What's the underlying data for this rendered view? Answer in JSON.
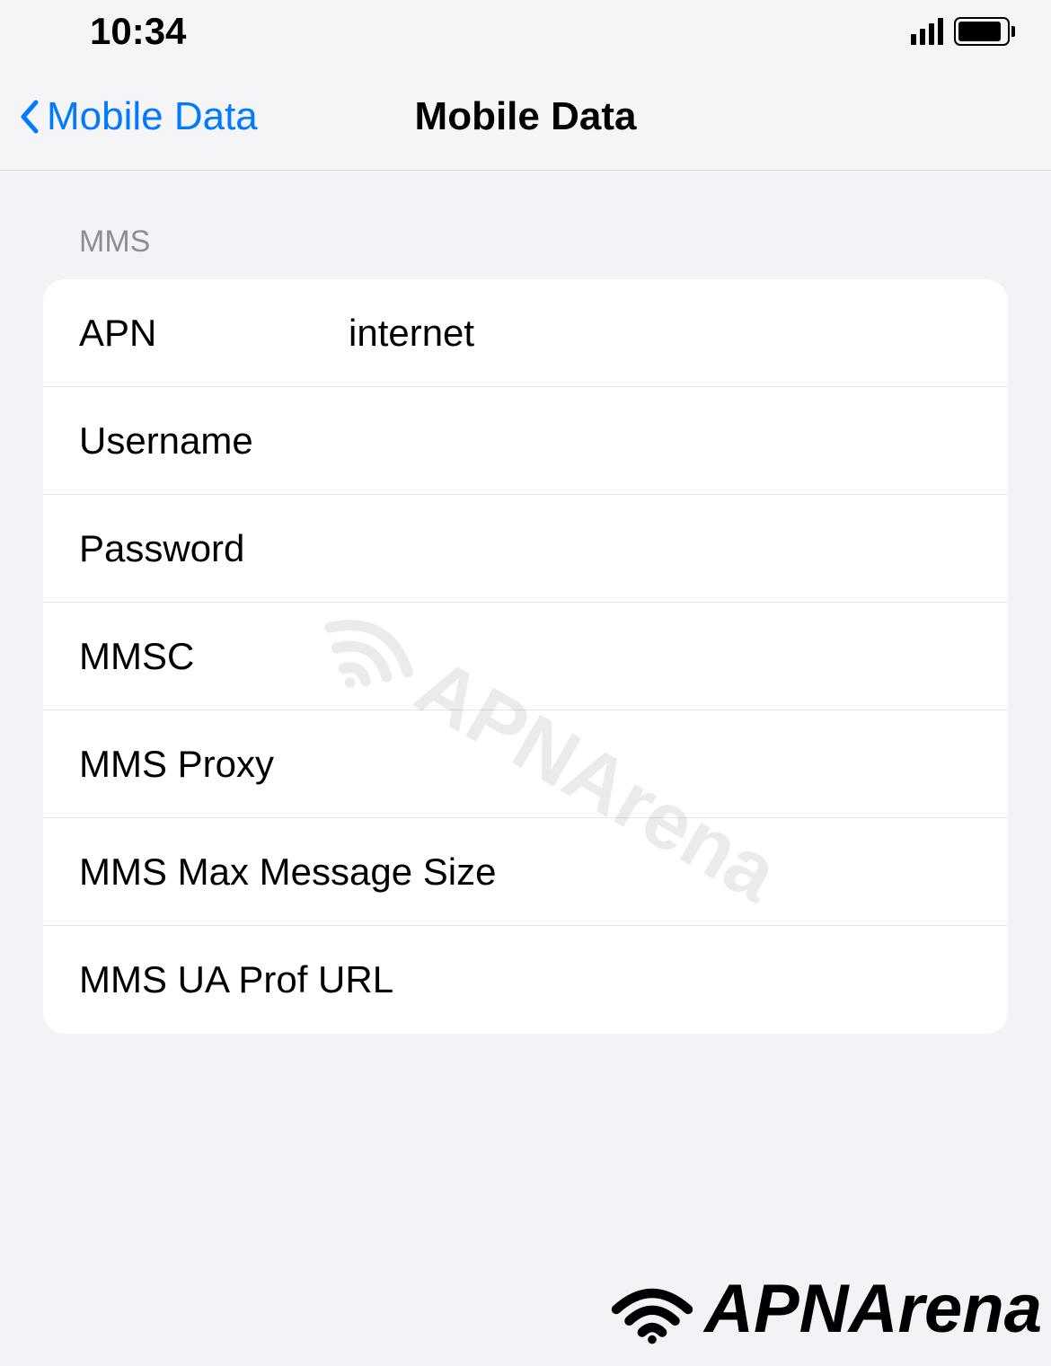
{
  "statusBar": {
    "time": "10:34"
  },
  "nav": {
    "backLabel": "Mobile Data",
    "title": "Mobile Data"
  },
  "section": {
    "header": "MMS",
    "rows": [
      {
        "label": "APN",
        "value": "internet"
      },
      {
        "label": "Username",
        "value": ""
      },
      {
        "label": "Password",
        "value": ""
      },
      {
        "label": "MMSC",
        "value": ""
      },
      {
        "label": "MMS Proxy",
        "value": ""
      },
      {
        "label": "MMS Max Message Size",
        "value": ""
      },
      {
        "label": "MMS UA Prof URL",
        "value": ""
      }
    ]
  },
  "watermark": {
    "text": "APNArena"
  }
}
